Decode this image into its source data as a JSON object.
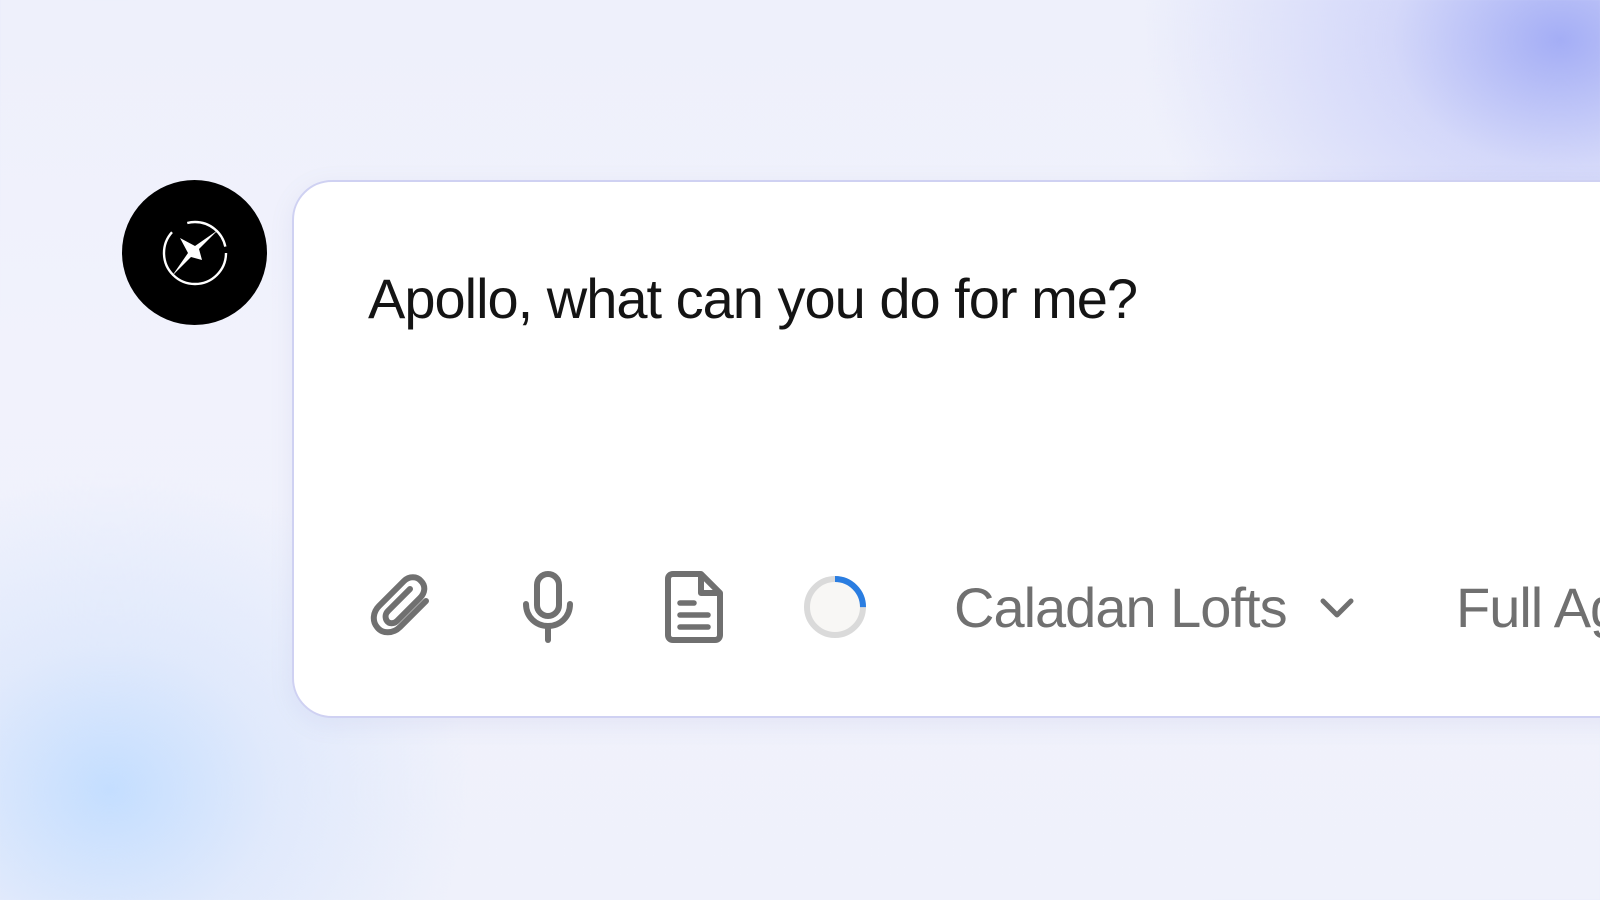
{
  "assistant": {
    "name": "Apollo",
    "avatar_icon": "sparkle-star-icon"
  },
  "composer": {
    "prompt_text": "Apollo, what can you do for me?",
    "toolbar": {
      "attach_icon": "paperclip-icon",
      "voice_icon": "microphone-icon",
      "document_icon": "document-icon",
      "progress_icon": "loading-ring-icon",
      "progress_fraction": 0.25,
      "workspace_label": "Caladan Lofts",
      "workspace_icon": "chevron-down-icon",
      "mode_label": "Full Ag"
    }
  },
  "colors": {
    "accent_blue": "#2a7de1",
    "icon_gray": "#707070",
    "text_dark": "#141414",
    "card_border": "#cfd1f2"
  }
}
